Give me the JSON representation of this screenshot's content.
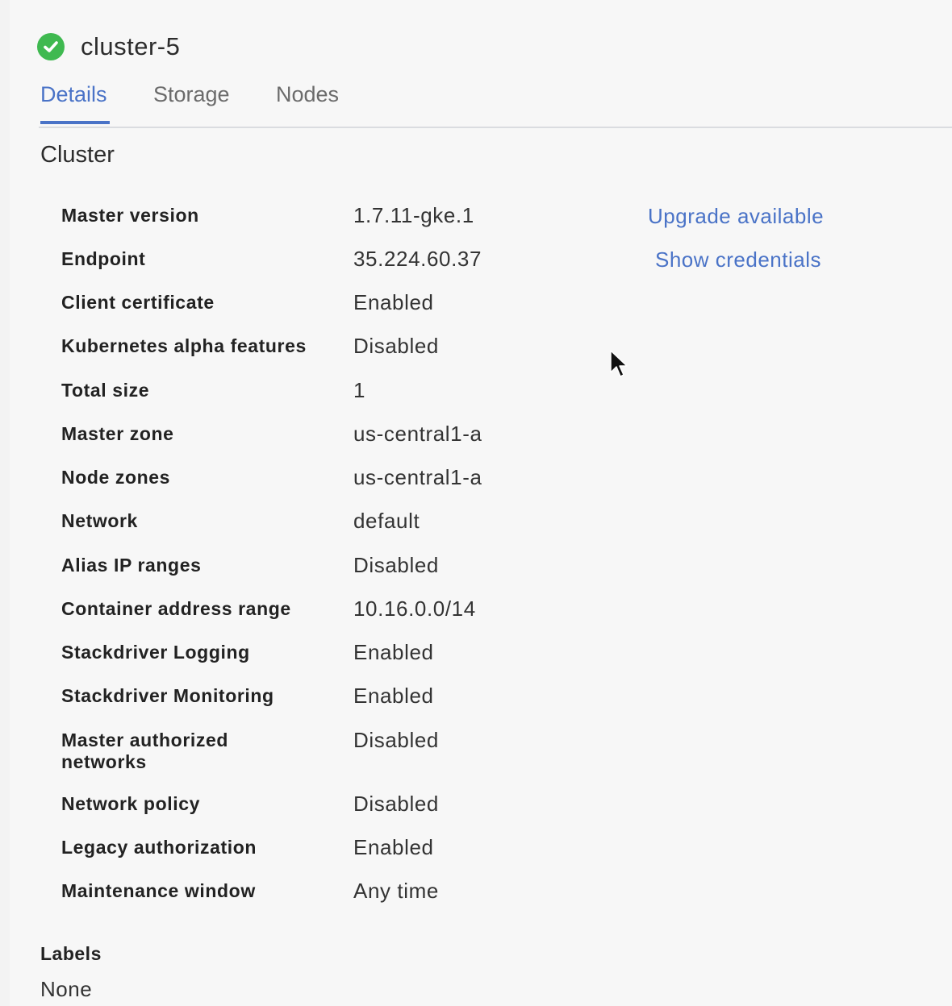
{
  "header": {
    "cluster_name": "cluster-5",
    "status_icon": "check-circle-icon",
    "status_color": "#3fb950"
  },
  "tabs": [
    {
      "label": "Details",
      "active": true
    },
    {
      "label": "Storage",
      "active": false
    },
    {
      "label": "Nodes",
      "active": false
    }
  ],
  "accent_color": "#4a73c7",
  "section": {
    "title": "Cluster"
  },
  "properties": [
    {
      "label": "Master version",
      "value": "1.7.11-gke.1"
    },
    {
      "label": "Endpoint",
      "value": "35.224.60.37"
    },
    {
      "label": "Client certificate",
      "value": "Enabled"
    },
    {
      "label": "Kubernetes alpha features",
      "value": "Disabled"
    },
    {
      "label": "Total size",
      "value": "1"
    },
    {
      "label": "Master zone",
      "value": "us-central1-a"
    },
    {
      "label": "Node zones",
      "value": "us-central1-a"
    },
    {
      "label": "Network",
      "value": "default"
    },
    {
      "label": "Alias IP ranges",
      "value": "Disabled"
    },
    {
      "label": "Container address range",
      "value": "10.16.0.0/14"
    },
    {
      "label": "Stackdriver Logging",
      "value": "Enabled"
    },
    {
      "label": "Stackdriver Monitoring",
      "value": "Enabled"
    },
    {
      "label": "Master authorized networks",
      "value": "Disabled"
    },
    {
      "label": "Network policy",
      "value": "Disabled"
    },
    {
      "label": "Legacy authorization",
      "value": "Enabled"
    },
    {
      "label": "Maintenance window",
      "value": "Any time"
    }
  ],
  "links": {
    "upgrade": "Upgrade available",
    "credentials": "Show credentials"
  },
  "labels_section": {
    "heading": "Labels",
    "value": "None"
  }
}
